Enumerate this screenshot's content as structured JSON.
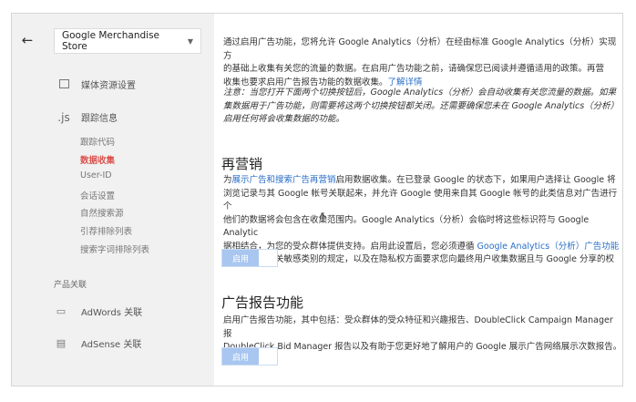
{
  "sidebar": {
    "back_icon": "←",
    "property": "Google Merchandise Store",
    "media": {
      "icon": "media-icon",
      "label": "媒体资源设置"
    },
    "tracking": {
      "icon": ".js",
      "label": "跟踪信息"
    },
    "sub_items": [
      "跟踪代码",
      "数据收集",
      "User-ID",
      "会话设置",
      "自然搜索源",
      "引荐排除列表",
      "搜索字词排除列表"
    ],
    "active_sub_item": "数据收集",
    "product_link_title": "产品关联",
    "links": [
      {
        "label": "AdWords 关联",
        "icon": "adwords-icon"
      },
      {
        "label": "AdSense 关联",
        "icon": "adsense-icon"
      }
    ]
  },
  "content": {
    "intro": {
      "line1": "通过启用广告功能，您将允许 Google Analytics（分析）在经由标准 Google Analytics（分析）实现方",
      "line2": "的基础上收集有关您的流量的数据。在启用广告功能之前，请确保您已阅读并遵循适用的政策。再营",
      "line3_pre": "收集也要求启用广告报告功能的数据收集。",
      "learn_more": "了解详情"
    },
    "note": {
      "line1": "注意：当您打开下面两个切换按钮后，Google Analytics（分析）会自动收集有关您流量的数据。如果",
      "line2": "集数据用于广告功能，则需要将这两个切换按钮都关闭。还需要确保您未在 Google Analytics（分析）",
      "line3": "启用任何将会收集数据的功能。"
    },
    "remarketing": {
      "title": "再营销",
      "line1_pre": "为",
      "line1_link": "展示广告和搜索广告再营销",
      "line1_post": "启用数据收集。在已登录 Google 的状态下，如果用户选择让 Google 将",
      "line2": "浏览记录与其 Google 帐号关联起来，并允许 Google 使用来自其 Google 帐号的此类信息对广告进行个",
      "line3": "他们的数据将会包含在收集范围内。Google Analytics（分析）会临时将这些标识符与 Google Analytic",
      "line4_pre": "据相结合，为您的受众群体提供支持。启用此设置后，您必须遵循 ",
      "line4_link": "Google Analytics（分析）广告功能",
      "line5": "要求，包括有关敏感类别的规定，以及在隐私权方面要求您向最终用户收集数据且与 Google 分享的权",
      "toggle_label": "启用"
    },
    "ad_reporting": {
      "title": "广告报告功能",
      "line1": "启用广告报告功能，其中包括：受众群体的受众特征和兴趣报告、DoubleClick Campaign Manager 报",
      "line2": "DoubleClick Bid Manager 报告以及有助于您更好地了解用户的 Google 展示广告网络展示次数报告。",
      "toggle_label": "启用"
    }
  }
}
